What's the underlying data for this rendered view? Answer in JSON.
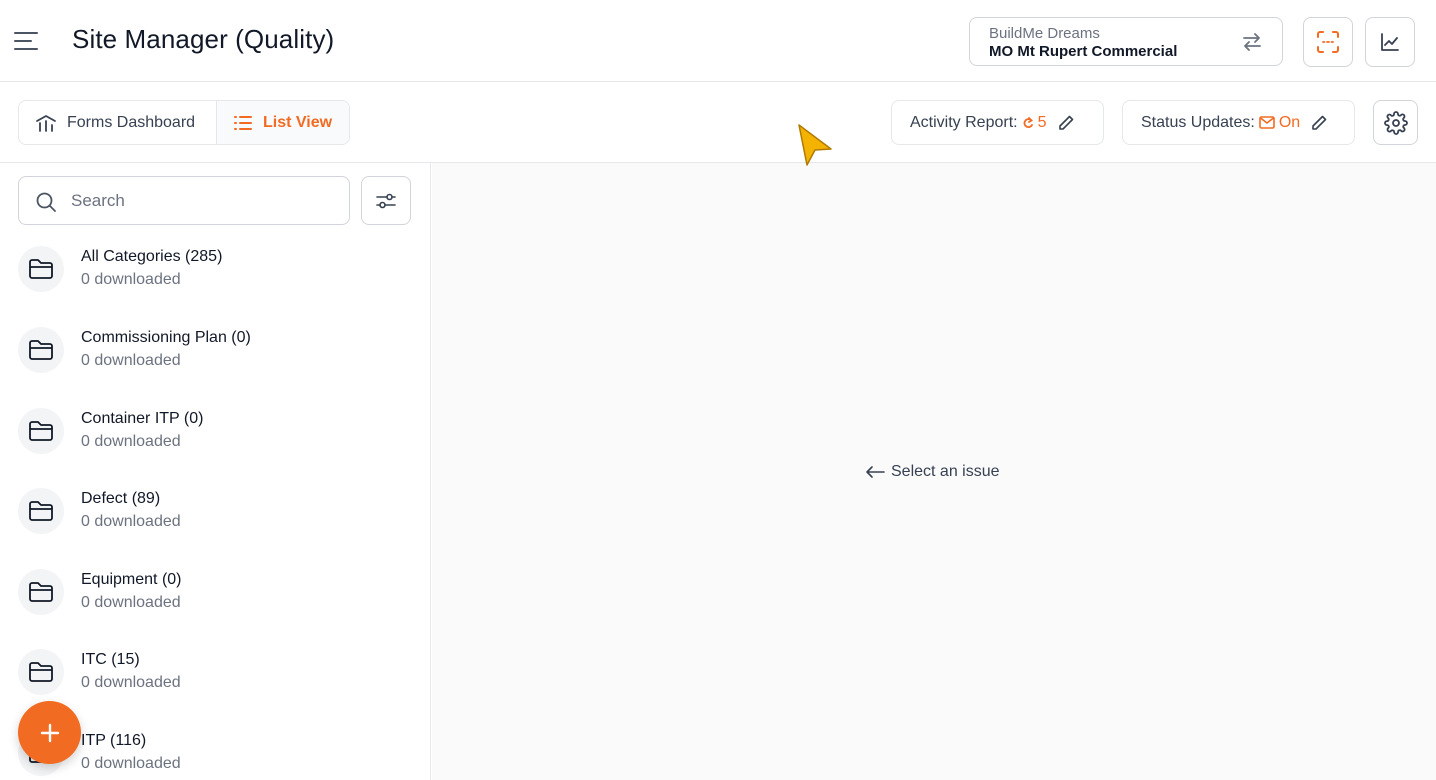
{
  "header": {
    "title": "Site Manager (Quality)",
    "project": {
      "org": "BuildMe Dreams",
      "name": "MO Mt Rupert Commercial"
    }
  },
  "toolbar": {
    "tabs": [
      {
        "label": "Forms Dashboard",
        "icon": "dashboard-icon",
        "active": false
      },
      {
        "label": "List View",
        "icon": "list-icon",
        "active": true
      }
    ],
    "activity_report": {
      "label": "Activity Report:",
      "value": "5"
    },
    "status_updates": {
      "label": "Status Updates:",
      "value": "On"
    }
  },
  "sidebar": {
    "search": {
      "placeholder": "Search",
      "value": ""
    },
    "categories": [
      {
        "title": "All Categories (285)",
        "subtitle": "0 downloaded"
      },
      {
        "title": "Commissioning Plan (0)",
        "subtitle": "0 downloaded"
      },
      {
        "title": "Container ITP (0)",
        "subtitle": "0 downloaded"
      },
      {
        "title": "Defect (89)",
        "subtitle": "0 downloaded"
      },
      {
        "title": "Equipment (0)",
        "subtitle": "0 downloaded"
      },
      {
        "title": "ITC (15)",
        "subtitle": "0 downloaded"
      },
      {
        "title": "ITP (116)",
        "subtitle": "0 downloaded"
      }
    ]
  },
  "main": {
    "empty_state": "Select an issue"
  },
  "colors": {
    "accent": "#f26b22",
    "border": "#e5e7eb",
    "muted_text": "#6b7280"
  }
}
